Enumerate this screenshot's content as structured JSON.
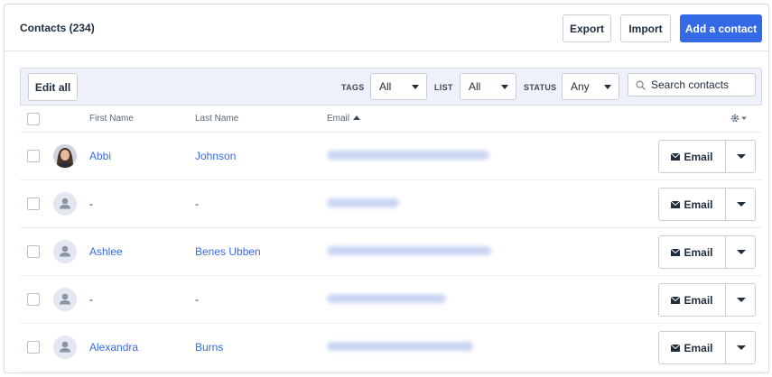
{
  "header": {
    "title": "Contacts (234)",
    "export_label": "Export",
    "import_label": "Import",
    "add_label": "Add a contact"
  },
  "filters": {
    "edit_all_label": "Edit all",
    "tags_label": "TAGS",
    "tags_value": "All",
    "list_label": "LIST",
    "list_value": "All",
    "status_label": "STATUS",
    "status_value": "Any",
    "search_placeholder": "Search contacts"
  },
  "table": {
    "columns": {
      "first_name": "First Name",
      "last_name": "Last Name",
      "email": "Email"
    },
    "rows": [
      {
        "first": "Abbi",
        "last": "Johnson",
        "avatar": "photo",
        "action": "Email"
      },
      {
        "first": "-",
        "last": "-",
        "avatar": "person-icon",
        "action": "Email"
      },
      {
        "first": "Ashlee",
        "last": "Benes Ubben",
        "avatar": "person-icon",
        "action": "Email"
      },
      {
        "first": "-",
        "last": "-",
        "avatar": "person-icon",
        "action": "Email"
      },
      {
        "first": "Alexandra",
        "last": "Burns",
        "avatar": "person-icon",
        "action": "Email"
      }
    ]
  },
  "colors": {
    "primary": "#356ae6",
    "filter_bg": "#eef1f9",
    "text": "#1f2d3d"
  }
}
